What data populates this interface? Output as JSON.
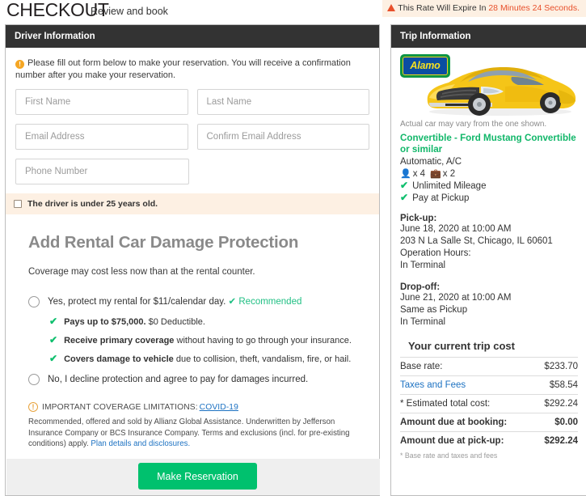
{
  "header": {
    "title": "CHECKOUT",
    "subtitle": "Review and book",
    "rate_notice_prefix": "This Rate Will Expire In",
    "rate_notice_time": "28 Minutes 24 Seconds.",
    "warning_icon": "warning-triangle-icon",
    "warning_color": "#e8502b"
  },
  "left_panel": {
    "heading": "Driver Information",
    "notice": {
      "icon": "info-circle-icon",
      "icon_glyph": "!",
      "text": "Please fill out form below to make your reservation. You will receive a confirmation number after you make your reservation."
    },
    "fields": {
      "first_name_placeholder": "First Name",
      "last_name_placeholder": "Last Name",
      "email_placeholder": "Email Address",
      "confirm_email_placeholder": "Confirm Email Address",
      "phone_placeholder": "Phone Number",
      "first_name_value": "",
      "last_name_value": "",
      "email_value": "",
      "confirm_email_value": "",
      "phone_value": ""
    },
    "age_checkbox": {
      "label": "The driver is under 25 years old.",
      "checked": false
    },
    "damage_protection": {
      "heading": "Add Rental Car Damage Protection",
      "subheading": "Coverage may cost less now than at the rental counter.",
      "accept_label": "Yes, protect my rental for $11/calendar day.",
      "recommended_label": "Recommended",
      "recommended_color": "#1fbf83",
      "bullets": [
        {
          "bold": "Pays up to $75,000.",
          "rest": " $0 Deductible."
        },
        {
          "bold": "Receive primary coverage",
          "rest": " without having to go through your insurance."
        },
        {
          "bold": "Covers damage to vehicle",
          "rest": " due to collision, theft, vandalism, fire, or hail."
        }
      ],
      "decline_label": "No, I decline protection and agree to pay for damages incurred.",
      "selected": "none"
    },
    "limitations": {
      "icon": "exclamation-circle-icon",
      "icon_glyph": "!",
      "heading": "IMPORTANT COVERAGE LIMITATIONS:",
      "heading_link": "COVID-19",
      "body_part1": "Recommended, offered and sold by Allianz Global Assistance. Underwritten by Jefferson Insurance Company or BCS Insurance Company. Terms and exclusions (incl. for pre-existing conditions) apply. ",
      "body_link": "Plan details and disclosures."
    },
    "submit_label": "Make Reservation",
    "submit_color": "#00c16e"
  },
  "right_panel": {
    "heading": "Trip Information",
    "brand": {
      "name": "Alamo",
      "logo_icon": "alamo-logo",
      "badge_bg": "#0b4ea2",
      "badge_border": "#0b9444",
      "text_color": "#f7e020"
    },
    "car_image_icon": "yellow-convertible-car-image",
    "car_disclaimer": "Actual car may vary from the one shown.",
    "car_title": "Convertible - Ford Mustang Convertible or similar",
    "car_title_color": "#12b76a",
    "car_spec": "Automatic, A/C",
    "passengers_icon": "person-icon",
    "passengers": "x 4",
    "bags_icon": "suitcase-icon",
    "bags": "x 2",
    "features": [
      {
        "icon": "check-icon",
        "label": "Unlimited Mileage"
      },
      {
        "icon": "check-icon",
        "label": "Pay at Pickup"
      }
    ],
    "pickup": {
      "title": "Pick-up:",
      "datetime": "June 18, 2020 at 10:00 AM",
      "address": "203 N La Salle St, Chicago, IL 60601",
      "hours_label": "Operation Hours:",
      "terminal": "In Terminal"
    },
    "dropoff": {
      "title": "Drop-off:",
      "datetime": "June 21, 2020 at 10:00 AM",
      "address": "Same as Pickup",
      "terminal": "In Terminal"
    },
    "cost": {
      "title": "Your current trip cost",
      "rows": [
        {
          "label": "Base rate:",
          "value": "$233.70",
          "link": false,
          "bold": false
        },
        {
          "label": "Taxes and Fees",
          "value": "$58.54",
          "link": true,
          "bold": false
        },
        {
          "label": "* Estimated total cost:",
          "value": "$292.24",
          "link": false,
          "bold": false
        },
        {
          "label": "Amount due at booking:",
          "value": "$0.00",
          "link": false,
          "bold": true
        },
        {
          "label": "Amount due at pick-up:",
          "value": "$292.24",
          "link": false,
          "bold": true
        }
      ],
      "footnote": "* Base rate and taxes and fees"
    }
  }
}
